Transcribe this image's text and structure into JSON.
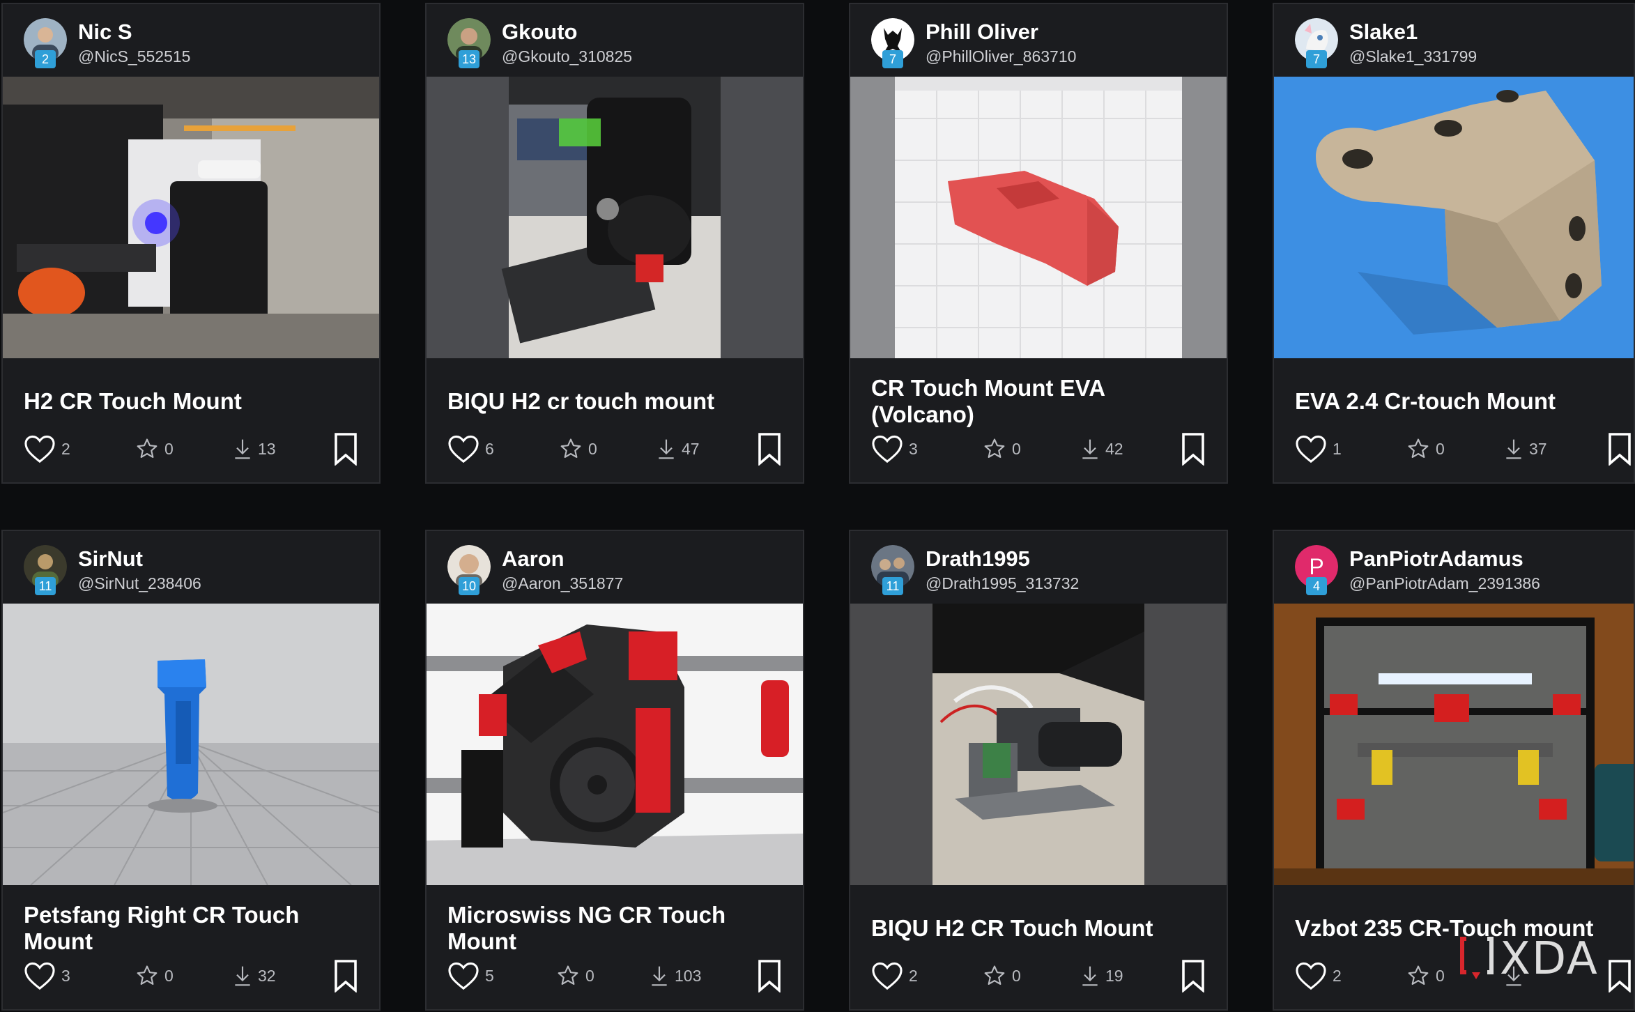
{
  "cards": [
    {
      "name": "Nic S",
      "handle": "@NicS_552515",
      "level": "2",
      "title": "H2 CR Touch Mount",
      "likes": "2",
      "stars": "0",
      "downloads": "13"
    },
    {
      "name": "Gkouto",
      "handle": "@Gkouto_310825",
      "level": "13",
      "title": "BIQU H2 cr touch mount",
      "likes": "6",
      "stars": "0",
      "downloads": "47"
    },
    {
      "name": "Phill Oliver",
      "handle": "@PhillOliver_863710",
      "level": "7",
      "title": "CR Touch Mount EVA (Volcano)",
      "likes": "3",
      "stars": "0",
      "downloads": "42"
    },
    {
      "name": "Slake1",
      "handle": "@Slake1_331799",
      "level": "7",
      "title": "EVA 2.4 Cr-touch Mount",
      "likes": "1",
      "stars": "0",
      "downloads": "37"
    },
    {
      "name": "SirNut",
      "handle": "@SirNut_238406",
      "level": "11",
      "title": "Petsfang Right CR Touch Mount",
      "likes": "3",
      "stars": "0",
      "downloads": "32"
    },
    {
      "name": "Aaron",
      "handle": "@Aaron_351877",
      "level": "10",
      "title": "Microswiss NG CR Touch Mount",
      "likes": "5",
      "stars": "0",
      "downloads": "103"
    },
    {
      "name": "Drath1995",
      "handle": "@Drath1995_313732",
      "level": "11",
      "title": "BIQU H2 CR Touch Mount",
      "likes": "2",
      "stars": "0",
      "downloads": "19"
    },
    {
      "name": "PanPiotrAdamus",
      "handle": "@PanPiotrAdam_2391386",
      "level": "4",
      "title": "Vzbot 235 CR-Touch mount",
      "likes": "2",
      "stars": "0",
      "downloads": "",
      "avatar_letter": "P"
    }
  ],
  "icons": {
    "like": "heart-icon",
    "star": "star-icon",
    "download": "download-icon",
    "save": "bookmark-icon"
  },
  "watermark": {
    "text": "XDA"
  },
  "colors": {
    "background": "#0c0d0f",
    "card": "#1b1c1f",
    "level_badge": "#2f9fd8",
    "avatar_p": "#e02a6b"
  }
}
